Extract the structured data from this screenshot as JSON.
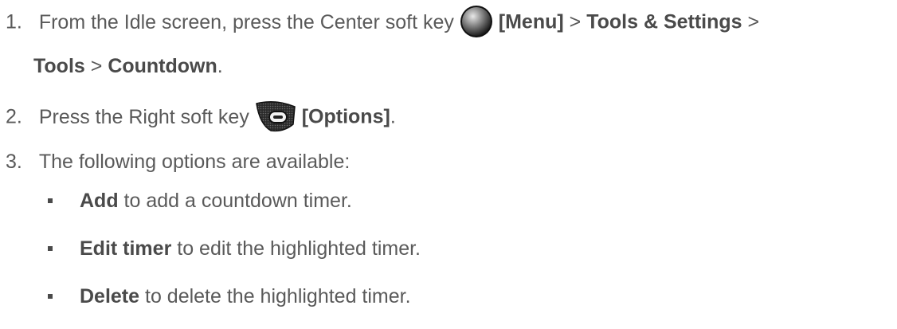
{
  "steps": [
    {
      "num": "1.",
      "line1": {
        "pre": "From the Idle screen, press the Center soft key ",
        "key_label": "[Menu]",
        "sep1": " > ",
        "item1": "Tools & Settings",
        "sep2": " >"
      },
      "line2": {
        "item2": "Tools",
        "sep3": " > ",
        "item3": "Countdown",
        "end": "."
      },
      "icon": "center-soft-key-icon"
    },
    {
      "num": "2.",
      "pre": "Press the Right soft key ",
      "key_label": "[Options]",
      "end": ".",
      "icon": "right-soft-key-icon"
    },
    {
      "num": "3.",
      "text": "The following options are available:"
    }
  ],
  "options": [
    {
      "term": "Add",
      "desc": " to add a countdown timer."
    },
    {
      "term": "Edit timer",
      "desc": " to edit the highlighted timer."
    },
    {
      "term": "Delete",
      "desc": " to delete the highlighted timer."
    }
  ]
}
